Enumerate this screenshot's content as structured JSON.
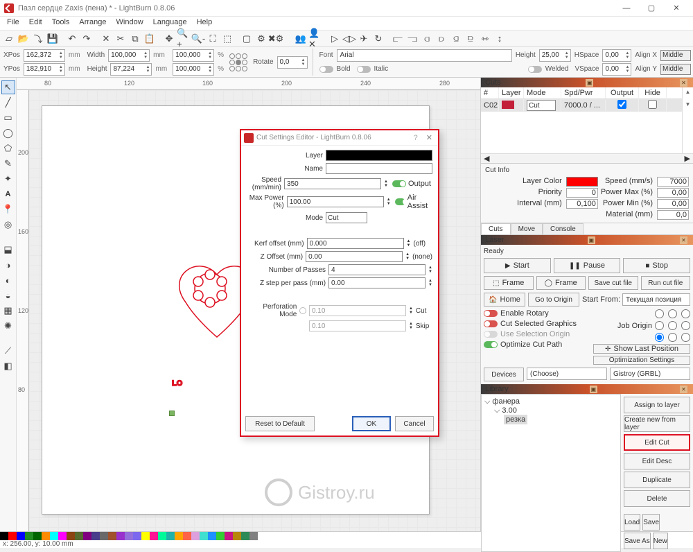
{
  "window": {
    "title": "Пазл сердце Zaxis (пена) * - LightBurn 0.8.06",
    "min_icon": "—",
    "max_icon": "▢",
    "close_icon": "✕"
  },
  "menu": [
    "File",
    "Edit",
    "Tools",
    "Arrange",
    "Window",
    "Language",
    "Help"
  ],
  "position": {
    "xpos_lbl": "XPos",
    "xpos": "162,372",
    "ypos_lbl": "YPos",
    "ypos": "182,910",
    "unit": "mm",
    "width_lbl": "Width",
    "width": "100,000",
    "height_lbl": "Height",
    "height": "87,224",
    "sx": "100,000",
    "sy": "100,000",
    "pct": "%",
    "rotate_lbl": "Rotate",
    "rotate": "0,0"
  },
  "typography": {
    "font_lbl": "Font",
    "font": "Arial",
    "height_lbl": "Height",
    "height": "25,00",
    "hspace_lbl": "HSpace",
    "hspace": "0,00",
    "vspace_lbl": "VSpace",
    "vspace": "0,00",
    "bold": "Bold",
    "italic": "Italic",
    "welded": "Welded",
    "alignx_lbl": "Align X",
    "alignx": "Middle",
    "aligny_lbl": "Align Y",
    "aligny": "Middle"
  },
  "ruler_h": [
    "80",
    "120",
    "160",
    "200",
    "240",
    "280"
  ],
  "ruler_v": [
    "200",
    "160",
    "120",
    "80"
  ],
  "cuts_panel": {
    "title": "Cuts",
    "cols": [
      "#",
      "Layer",
      "Mode",
      "Spd/Pwr",
      "Output",
      "Hide"
    ],
    "row": {
      "num": "C02",
      "color": "#c3203a",
      "mode": "Cut",
      "sp": "7000.0 / ..."
    }
  },
  "cut_info": {
    "title": "Cut Info",
    "layer_color_lbl": "Layer Color",
    "layer_color": "#ff0000",
    "speed_lbl": "Speed  (mm/s)",
    "speed": "7000",
    "priority_lbl": "Priority",
    "priority": "0",
    "power_max_lbl": "Power Max (%)",
    "power_max": "0,00",
    "interval_lbl": "Interval (mm)",
    "interval": "0,100",
    "power_min_lbl": "Power Min (%)",
    "power_min": "0,00",
    "material_lbl": "Material (mm)",
    "material": "0,0"
  },
  "tabs": [
    "Cuts",
    "Move",
    "Console"
  ],
  "laser": {
    "title": "Laser",
    "ready": "Ready",
    "start": "Start",
    "pause": "Pause",
    "stop": "Stop",
    "frame1": "Frame",
    "frame2": "Frame",
    "save": "Save cut file",
    "run": "Run cut file",
    "home": "Home",
    "goto": "Go to Origin",
    "start_from_lbl": "Start From:",
    "start_from": "Текущая позиция",
    "job_origin_lbl": "Job Origin",
    "enable_rotary": "Enable Rotary",
    "cut_sel": "Cut Selected Graphics",
    "use_sel_origin": "Use Selection Origin",
    "optimize": "Optimize Cut Path",
    "show_last": "Show Last Position",
    "opt_settings": "Optimization Settings",
    "devices": "Devices",
    "choose": "(Choose)",
    "device": "Gistroy (GRBL)"
  },
  "library": {
    "title": "Library",
    "root": "фанера",
    "sub": "3.00",
    "leaf": "резка",
    "assign": "Assign to layer",
    "create": "Create new from layer",
    "edit_cut": "Edit Cut",
    "edit_desc": "Edit Desc",
    "dup": "Duplicate",
    "del": "Delete",
    "load": "Load",
    "save": "Save",
    "saveas": "Save As",
    "new": "New"
  },
  "dialog": {
    "title": "Cut Settings Editor - LightBurn 0.8.06",
    "layer_lbl": "Layer",
    "name_lbl": "Name",
    "speed_lbl": "Speed (mm/min)",
    "speed": "350",
    "output": "Output",
    "power_lbl": "Max Power (%)",
    "power": "100.00",
    "air": "Air Assist",
    "mode_lbl": "Mode",
    "mode": "Cut",
    "kerf_lbl": "Kerf offset (mm)",
    "kerf": "0.000",
    "kerf_state": "(off)",
    "zoff_lbl": "Z Offset (mm)",
    "zoff": "0.00",
    "zoff_state": "(none)",
    "passes_lbl": "Number of Passes",
    "passes": "4",
    "zstep_lbl": "Z step per pass (mm)",
    "zstep": "0.00",
    "perf_lbl": "Perforation Mode",
    "perf_cut": "0.10",
    "perf_cut_l": "Cut",
    "perf_skip": "0.10",
    "perf_skip_l": "Skip",
    "reset": "Reset to Default",
    "ok": "OK",
    "cancel": "Cancel"
  },
  "watermark": "Gistroy.ru",
  "status": "x: 256.00, y: 10.00 mm",
  "swatch_colors": [
    "#000000",
    "#ff0000",
    "#0000ff",
    "#228b22",
    "#006400",
    "#ff8c00",
    "#00ffff",
    "#ff00ff",
    "#8b4513",
    "#556b2f",
    "#800080",
    "#483d8b",
    "#696969",
    "#a0522d",
    "#9932cc",
    "#9370db",
    "#7b68ee",
    "#ffff00",
    "#ff1493",
    "#00fa9a",
    "#20b2aa",
    "#ffa500",
    "#ff6347",
    "#dda0dd",
    "#40e0d0",
    "#1e90ff",
    "#32cd32",
    "#c71585",
    "#b8860b",
    "#2e8b57",
    "#808080"
  ]
}
